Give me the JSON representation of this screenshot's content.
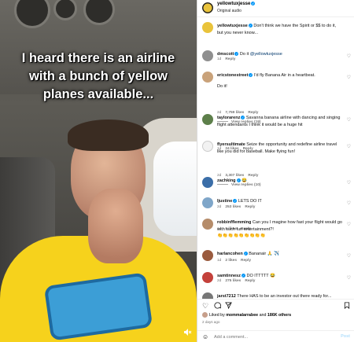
{
  "video": {
    "caption": "I heard there is an airline with a bunch of yellow planes available...",
    "volume_icon": "speaker-muted-icon"
  },
  "post": {
    "username": "yellowtuxjesse",
    "audio": "Original audio",
    "avatar_color": "#e9c33b"
  },
  "comments": [
    {
      "user": "yellowtuxjesse",
      "text": "Don't think we have the Spirit or $$ to do it, but you never know...",
      "meta": [],
      "avatar_color": "#e9c33b",
      "verified": true
    },
    {
      "user": "dmscott",
      "mention": "@yellowtuxjesse",
      "text": "Do it ",
      "meta": [
        "1d",
        "Reply"
      ],
      "avatar_color": "#8f8f8f",
      "verified": true
    },
    {
      "user": "ericstonestreet",
      "text": "I'd fly Banana Air in a heartbeat.",
      "text2": "Do it!",
      "meta": [
        "2d",
        "7,759 likes",
        "Reply"
      ],
      "replies": "View replies (19)",
      "avatar_color": "#c9a27a",
      "verified": true
    },
    {
      "user": "taylorarenz",
      "text": "Savanna banana airline with dancing and singing flight attendants I think it would be a huge hit",
      "meta": [
        "1d",
        "24 likes",
        "Reply"
      ],
      "avatar_color": "#5d7f4a",
      "verified": true
    },
    {
      "user": "flyersultimate",
      "text": "Seize the opportunity and redefine airline travel like you did for baseball. Make flying fun!",
      "meta": [
        "2d",
        "3,307 likes",
        "Reply"
      ],
      "replies": "View replies (10)",
      "avatar_color": "#f2f2f2",
      "verified": false
    },
    {
      "user": "zachking",
      "text": "😂",
      "meta": [
        "2d",
        "253 likes",
        "Reply"
      ],
      "avatar_color": "#3b6ea8",
      "verified": true
    },
    {
      "user": "ljustine",
      "text": "LETS DO IT",
      "meta": [
        "1d",
        "9 likes",
        "Reply"
      ],
      "avatar_color": "#7fa6c9",
      "verified": true
    },
    {
      "user": "robbinfflemming",
      "text": "Can you I magine how fast your flight would go with such fun entertainment?!",
      "text2": "👏👏👏👏👏👏👏👏👏",
      "meta": [
        "1d",
        "2 likes",
        "Reply"
      ],
      "avatar_color": "#b58c6a",
      "verified": false
    },
    {
      "user": "harlancohen",
      "text": "Bananair 🙏 ✈️",
      "meta": [
        "2d",
        "275 likes",
        "Reply"
      ],
      "avatar_color": "#9a5b3e",
      "verified": true
    },
    {
      "user": "samtinnesz",
      "text": "DO ITTTTT 😂",
      "meta": [
        "2d",
        "107 likes",
        "Reply"
      ],
      "avatar_color": "#c4413b",
      "verified": true
    },
    {
      "user": "jarst7212",
      "text": "There HAS to be an investor out there ready for...",
      "meta": [],
      "avatar_color": "#777777",
      "verified": false
    }
  ],
  "footer": {
    "liked_by_prefix": "Liked by ",
    "liked_by_user": "mommalarrabee",
    "liked_by_and": " and ",
    "liked_by_count": "186K others",
    "ago": "2 days ago",
    "comment_placeholder": "Add a comment...",
    "post_label": "Post"
  },
  "icons": {
    "like": "heart-icon",
    "comment": "comment-icon",
    "share": "share-icon",
    "save": "bookmark-icon",
    "emoji": "smiley-icon"
  },
  "colors": {
    "accent": "#0095f6",
    "shirt": "#f6d21c"
  }
}
